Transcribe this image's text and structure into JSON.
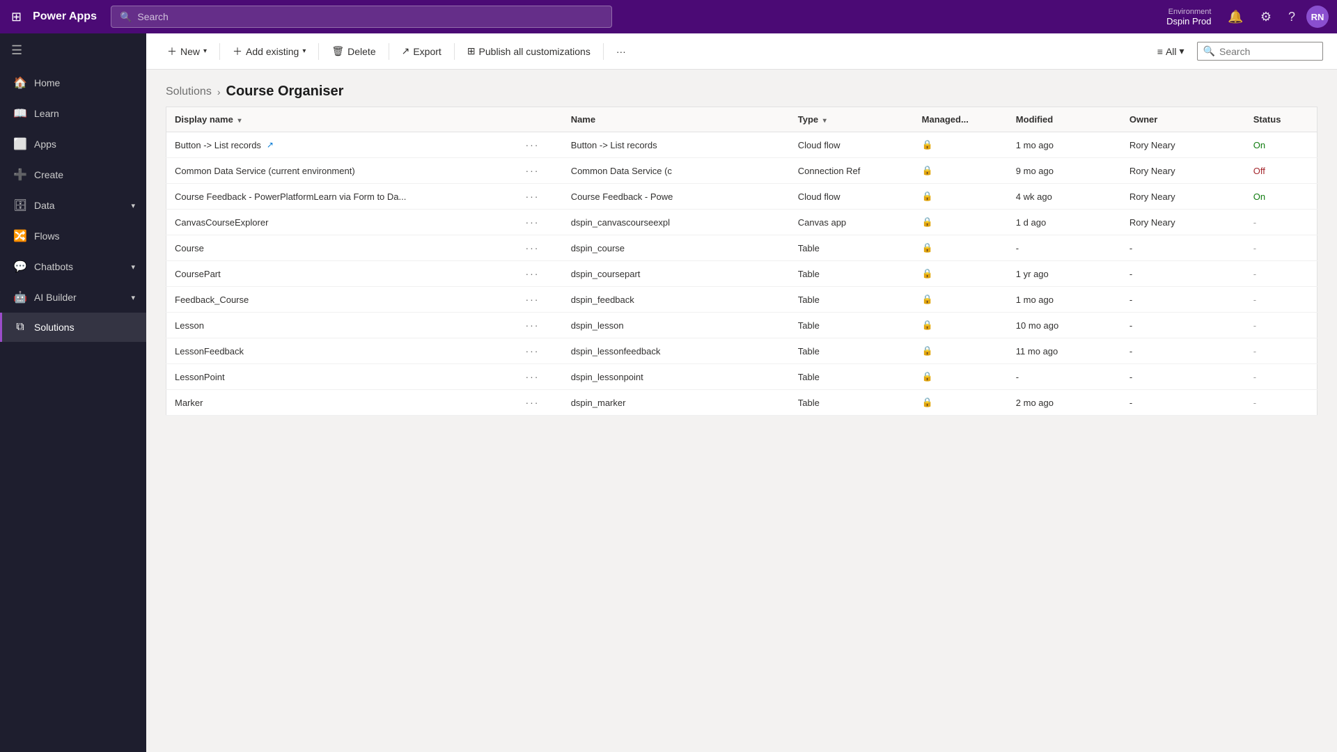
{
  "topNav": {
    "appName": "Power Apps",
    "searchPlaceholder": "Search",
    "environment": {
      "label": "Environment",
      "name": "Dspin Prod"
    },
    "avatarInitials": "RN"
  },
  "sidebar": {
    "toggleLabel": "Collapse",
    "items": [
      {
        "id": "home",
        "label": "Home",
        "icon": "🏠",
        "hasChevron": false,
        "active": false
      },
      {
        "id": "learn",
        "label": "Learn",
        "icon": "📖",
        "hasChevron": false,
        "active": false
      },
      {
        "id": "apps",
        "label": "Apps",
        "icon": "⬜",
        "hasChevron": false,
        "active": false
      },
      {
        "id": "create",
        "label": "Create",
        "icon": "➕",
        "hasChevron": false,
        "active": false
      },
      {
        "id": "data",
        "label": "Data",
        "icon": "🗄",
        "hasChevron": true,
        "active": false
      },
      {
        "id": "flows",
        "label": "Flows",
        "icon": "🔀",
        "hasChevron": false,
        "active": false
      },
      {
        "id": "chatbots",
        "label": "Chatbots",
        "icon": "💬",
        "hasChevron": true,
        "active": false
      },
      {
        "id": "ai-builder",
        "label": "AI Builder",
        "icon": "🤖",
        "hasChevron": true,
        "active": false
      },
      {
        "id": "solutions",
        "label": "Solutions",
        "icon": "⧉",
        "hasChevron": false,
        "active": true
      }
    ]
  },
  "commandBar": {
    "newLabel": "New",
    "addExistingLabel": "Add existing",
    "deleteLabel": "Delete",
    "exportLabel": "Export",
    "publishLabel": "Publish all customizations",
    "moreLabel": "···",
    "filterLabel": "All",
    "searchPlaceholder": "Search"
  },
  "breadcrumb": {
    "parentLabel": "Solutions",
    "currentLabel": "Course Organiser"
  },
  "table": {
    "columns": [
      {
        "id": "display-name",
        "label": "Display name",
        "sortable": true
      },
      {
        "id": "menu",
        "label": ""
      },
      {
        "id": "name",
        "label": "Name"
      },
      {
        "id": "type",
        "label": "Type",
        "sortable": true
      },
      {
        "id": "managed",
        "label": "Managed..."
      },
      {
        "id": "modified",
        "label": "Modified"
      },
      {
        "id": "owner",
        "label": "Owner"
      },
      {
        "id": "status",
        "label": "Status"
      }
    ],
    "rows": [
      {
        "displayName": "Button -> List records",
        "hasExternalLink": true,
        "name": "Button -> List records",
        "type": "Cloud flow",
        "managed": true,
        "modified": "1 mo ago",
        "owner": "Rory Neary",
        "status": "On"
      },
      {
        "displayName": "Common Data Service (current environment)",
        "hasExternalLink": false,
        "name": "Common Data Service (c",
        "type": "Connection Ref",
        "managed": true,
        "modified": "9 mo ago",
        "owner": "Rory Neary",
        "status": "Off"
      },
      {
        "displayName": "Course Feedback - PowerPlatformLearn via Form to Da...",
        "hasExternalLink": false,
        "name": "Course Feedback - Powe",
        "type": "Cloud flow",
        "managed": true,
        "modified": "4 wk ago",
        "owner": "Rory Neary",
        "status": "On"
      },
      {
        "displayName": "CanvasCourseExplorer",
        "hasExternalLink": false,
        "name": "dspin_canvascourseexpl",
        "type": "Canvas app",
        "managed": true,
        "modified": "1 d ago",
        "owner": "Rory Neary",
        "status": "-"
      },
      {
        "displayName": "Course",
        "hasExternalLink": false,
        "name": "dspin_course",
        "type": "Table",
        "managed": true,
        "modified": "-",
        "owner": "-",
        "status": "-"
      },
      {
        "displayName": "CoursePart",
        "hasExternalLink": false,
        "name": "dspin_coursepart",
        "type": "Table",
        "managed": true,
        "modified": "1 yr ago",
        "owner": "-",
        "status": "-"
      },
      {
        "displayName": "Feedback_Course",
        "hasExternalLink": false,
        "name": "dspin_feedback",
        "type": "Table",
        "managed": true,
        "modified": "1 mo ago",
        "owner": "-",
        "status": "-"
      },
      {
        "displayName": "Lesson",
        "hasExternalLink": false,
        "name": "dspin_lesson",
        "type": "Table",
        "managed": true,
        "modified": "10 mo ago",
        "owner": "-",
        "status": "-"
      },
      {
        "displayName": "LessonFeedback",
        "hasExternalLink": false,
        "name": "dspin_lessonfeedback",
        "type": "Table",
        "managed": true,
        "modified": "11 mo ago",
        "owner": "-",
        "status": "-"
      },
      {
        "displayName": "LessonPoint",
        "hasExternalLink": false,
        "name": "dspin_lessonpoint",
        "type": "Table",
        "managed": true,
        "modified": "-",
        "owner": "-",
        "status": "-"
      },
      {
        "displayName": "Marker",
        "hasExternalLink": false,
        "name": "dspin_marker",
        "type": "Table",
        "managed": true,
        "modified": "2 mo ago",
        "owner": "-",
        "status": "-"
      }
    ]
  }
}
